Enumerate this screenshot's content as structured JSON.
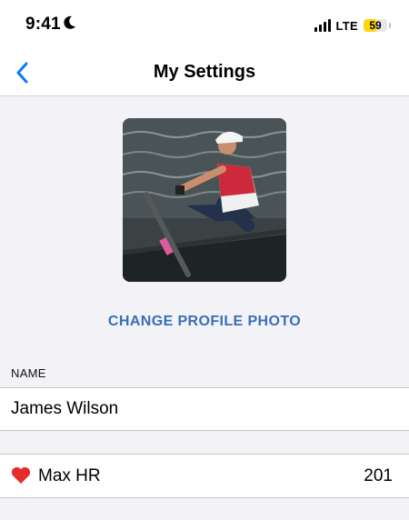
{
  "status": {
    "time": "9:41",
    "network": "LTE",
    "battery": "59",
    "battery_level": 0.59,
    "battery_color": "#ffd60a",
    "icons": [
      "moon-icon",
      "signal-icon",
      "battery-icon"
    ]
  },
  "nav": {
    "title": "My Settings",
    "back_icon": "chevron-left-icon",
    "accent": "#0a7aff"
  },
  "profile": {
    "photo_alt": "Rower in a single scull",
    "change_photo_label": "CHANGE PROFILE PHOTO",
    "link_color": "#3a6fb8"
  },
  "form": {
    "name_header": "NAME",
    "name_value": "James Wilson",
    "max_hr_label": "Max HR",
    "max_hr_value": "201",
    "max_hr_icon": "heart-icon"
  }
}
